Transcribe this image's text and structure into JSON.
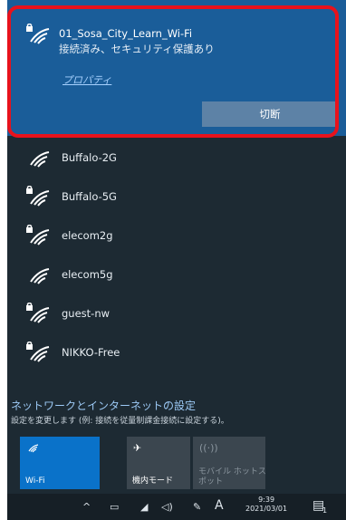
{
  "connected": {
    "name": "01_Sosa_City_Learn_Wi-Fi",
    "status": "接続済み、セキュリティ保護あり",
    "properties_label": "プロパティ",
    "disconnect_label": "切断",
    "icon": "wifi-secured-icon"
  },
  "networks": [
    {
      "name": "Buffalo-2G",
      "icon": "wifi-open-icon"
    },
    {
      "name": "Buffalo-5G",
      "icon": "wifi-secured-icon"
    },
    {
      "name": "elecom2g",
      "icon": "wifi-secured-icon"
    },
    {
      "name": "elecom5g",
      "icon": "wifi-open-icon"
    },
    {
      "name": "guest-nw",
      "icon": "wifi-secured-icon"
    },
    {
      "name": "NIKKO-Free",
      "icon": "wifi-secured-icon"
    }
  ],
  "settings": {
    "link": "ネットワークとインターネットの設定",
    "description": "設定を変更します (例: 接続を従量制課金接続に設定する)。"
  },
  "quick_actions": {
    "wifi_label": "Wi-Fi",
    "airplane_label": "機内モード",
    "hotspot_label_line1": "モバイル ホットス",
    "hotspot_label_line2": "ポット"
  },
  "taskbar": {
    "time": "9:39",
    "date": "2021/03/01",
    "ime_label": "A",
    "notification_count": "1"
  },
  "colors": {
    "panel": "#1d2a33",
    "connected_bg": "#1a5d99",
    "accent": "#0a72c9",
    "highlight": "#e8121c"
  }
}
